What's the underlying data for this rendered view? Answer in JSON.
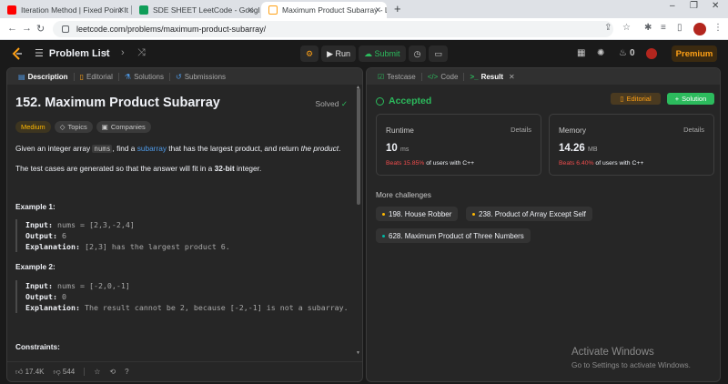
{
  "browser": {
    "tabs": [
      {
        "title": "Iteration Method | Fixed Point It",
        "icon_color": "#ff0000",
        "icon": "youtube-icon"
      },
      {
        "title": "SDE SHEET LeetCode - Google S",
        "icon_color": "#0f9d58",
        "icon": "sheets-icon"
      },
      {
        "title": "Maximum Product Subarray - Le",
        "icon_color": "#ffa116",
        "icon": "leetcode-icon"
      }
    ],
    "url": "leetcode.com/problems/maximum-product-subarray/"
  },
  "nav": {
    "problem_list": "Problem List",
    "run": "Run",
    "submit": "Submit",
    "streak": "0",
    "premium": "Premium"
  },
  "left": {
    "tabs": [
      "Description",
      "Editorial",
      "Solutions",
      "Submissions"
    ],
    "title": "152. Maximum Product Subarray",
    "solved": "Solved",
    "tags": [
      "Medium",
      "Topics",
      "Companies"
    ],
    "intro_1": "Given an integer array ",
    "intro_code": "nums",
    "intro_2": ", find a ",
    "intro_link": "subarray",
    "intro_3": " that has the largest product, and return ",
    "intro_em": "the product",
    "intro_4": ".",
    "guarantee_1": "The test cases are generated so that the answer will fit in a ",
    "guarantee_b": "32-bit",
    "guarantee_2": " integer.",
    "example1_heading": "Example 1:",
    "example1": {
      "input_label": "Input:",
      "input": "nums = [2,3,-2,4]",
      "output_label": "Output:",
      "output": "6",
      "expl_label": "Explanation:",
      "expl": "[2,3] has the largest product 6."
    },
    "example2_heading": "Example 2:",
    "example2": {
      "input_label": "Input:",
      "input": "nums = [-2,0,-1]",
      "output_label": "Output:",
      "output": "0",
      "expl_label": "Explanation:",
      "expl": "The result cannot be 2, because [-2,-1] is not a subarray."
    },
    "constraints": "Constraints:",
    "likes": "17.4K",
    "dislikes": "544"
  },
  "right": {
    "tabs": [
      "Testcase",
      "Code",
      "Result"
    ],
    "status": "Accepted",
    "editorial_btn": "Editorial",
    "solution_btn": "Solution",
    "runtime": {
      "label": "Runtime",
      "details": "Details",
      "value": "10",
      "unit": "ms",
      "beats": "Beats 15.85%",
      "suffix": " of users with C++"
    },
    "memory": {
      "label": "Memory",
      "details": "Details",
      "value": "14.26",
      "unit": "MB",
      "beats": "Beats 6.40%",
      "suffix": " of users with C++"
    },
    "more_label": "More challenges",
    "challenges": [
      "198. House Robber",
      "238. Product of Array Except Self",
      "628. Maximum Product of Three Numbers"
    ]
  },
  "windows": {
    "line1": "Activate Windows",
    "line2": "Go to Settings to activate Windows."
  },
  "colors": {
    "accent": "#ffa116",
    "success": "#2cbb5d",
    "danger": "#f04c4c",
    "link": "#4e9ae8"
  }
}
